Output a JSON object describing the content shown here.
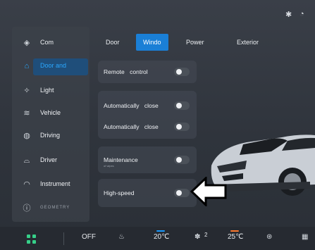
{
  "status": {
    "bluetooth_icon": "bluetooth-icon",
    "wifi_icon": "wifi-icon"
  },
  "sidebar": {
    "items": [
      {
        "label": "Com",
        "icon": "layers-icon"
      },
      {
        "label": "Door and",
        "icon": "car-door-icon",
        "active": true
      },
      {
        "label": "Light",
        "icon": "light-icon"
      },
      {
        "label": "Vehicle",
        "icon": "vehicle-settings-icon"
      },
      {
        "label": "Driving",
        "icon": "steering-wheel-icon"
      },
      {
        "label": "Driver",
        "icon": "driver-assist-icon"
      },
      {
        "label": "Instrument",
        "icon": "instrument-gauge-icon"
      },
      {
        "label": "GEOMETRY",
        "icon": "info-icon"
      }
    ]
  },
  "tabs": [
    {
      "label": "Door"
    },
    {
      "label": "Windo",
      "active": true
    },
    {
      "label": "Power"
    },
    {
      "label": "Exterior"
    }
  ],
  "settings": {
    "remote_control": {
      "label": "Remote control",
      "enabled": false
    },
    "auto_close_1": {
      "label": "Automatically close",
      "enabled": false
    },
    "auto_close_2": {
      "label": "Automatically close",
      "enabled": false
    },
    "maintenance": {
      "label": "Maintenance",
      "sub": "of wipes",
      "enabled": false
    },
    "high_speed": {
      "label": "High-speed",
      "enabled": false
    }
  },
  "bottom_bar": {
    "ac_state": "OFF",
    "left_temp": "20℃",
    "fan_level": "2",
    "right_temp": "25℃",
    "accent_left": "#1a9bff",
    "accent_right": "#ff7a2e"
  },
  "colors": {
    "accent": "#1a7fd6",
    "active_text": "#2aa8ff",
    "green": "#36d089"
  }
}
